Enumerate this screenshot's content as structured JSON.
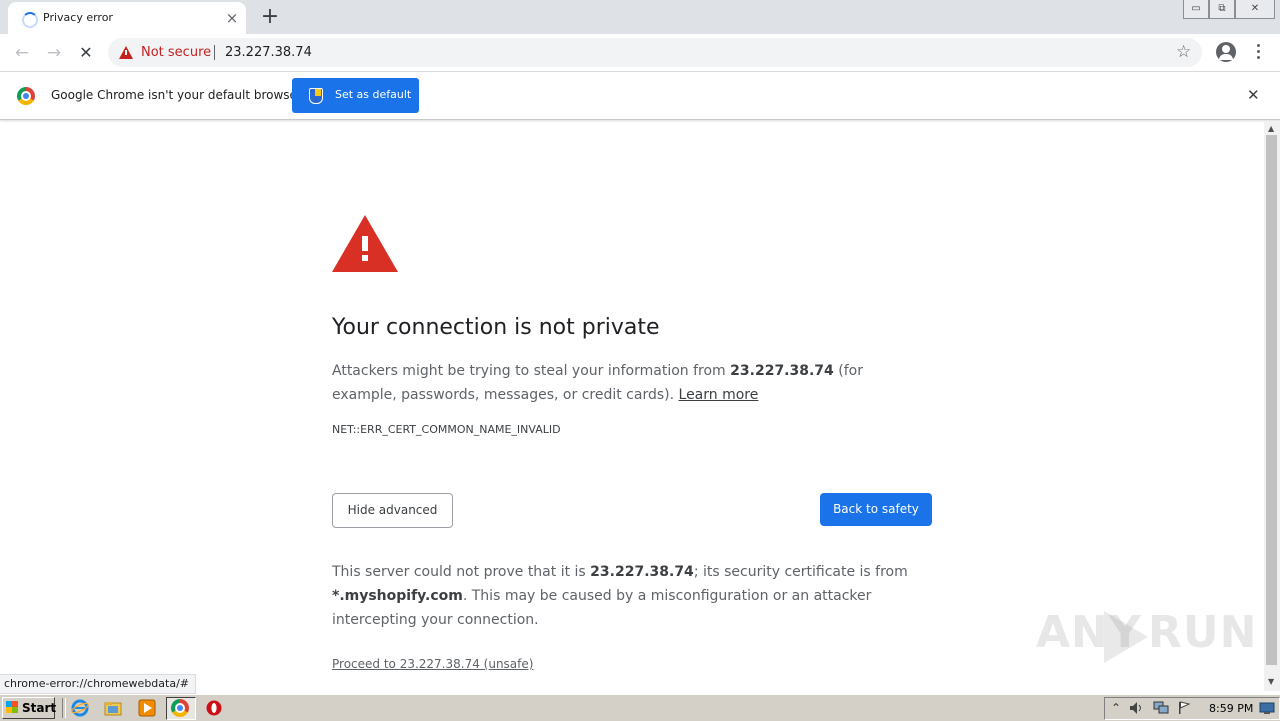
{
  "browser": {
    "tab": {
      "title": "Privacy error",
      "close_icon": "×"
    },
    "new_tab_icon": "+",
    "window_controls": {
      "minimize": "▭",
      "restore": "⧉",
      "close": "✕"
    },
    "toolbar": {
      "back_icon": "←",
      "forward_icon": "→",
      "stop_icon": "✕",
      "security_label": "Not secure",
      "url": "23.227.38.74",
      "bookmark_icon": "☆"
    },
    "infobar": {
      "message": "Google Chrome isn't your default browser",
      "button_label": "Set as default",
      "close_icon": "✕"
    },
    "status_bubble": "chrome-error://chromewebdata/#"
  },
  "interstitial": {
    "headline": "Your connection is not private",
    "message_pre": "Attackers might be trying to steal your information from ",
    "message_host": "23.227.38.74",
    "message_post": " (for example, passwords, messages, or credit cards). ",
    "learn_more": "Learn more",
    "error_code": "NET::ERR_CERT_COMMON_NAME_INVALID",
    "hide_advanced_label": "Hide advanced",
    "back_to_safety_label": "Back to safety",
    "details_pre": "This server could not prove that it is ",
    "details_host": "23.227.38.74",
    "details_mid": "; its security certificate is from ",
    "details_cert": "*.myshopify.com",
    "details_post": ". This may be caused by a misconfiguration or an attacker intercepting your connection.",
    "proceed_link": "Proceed to 23.227.38.74 (unsafe)",
    "danger_color": "#d93025",
    "accent_color": "#1a73e8"
  },
  "watermark": {
    "text_left": "ANY",
    "text_right": "RUN"
  },
  "taskbar": {
    "start_label": "Start",
    "pinned": [
      "internet-explorer-icon",
      "file-explorer-icon",
      "media-player-icon",
      "chrome-icon",
      "opera-icon"
    ],
    "tray_chevron": "⌃",
    "clock": "8:59 PM"
  }
}
